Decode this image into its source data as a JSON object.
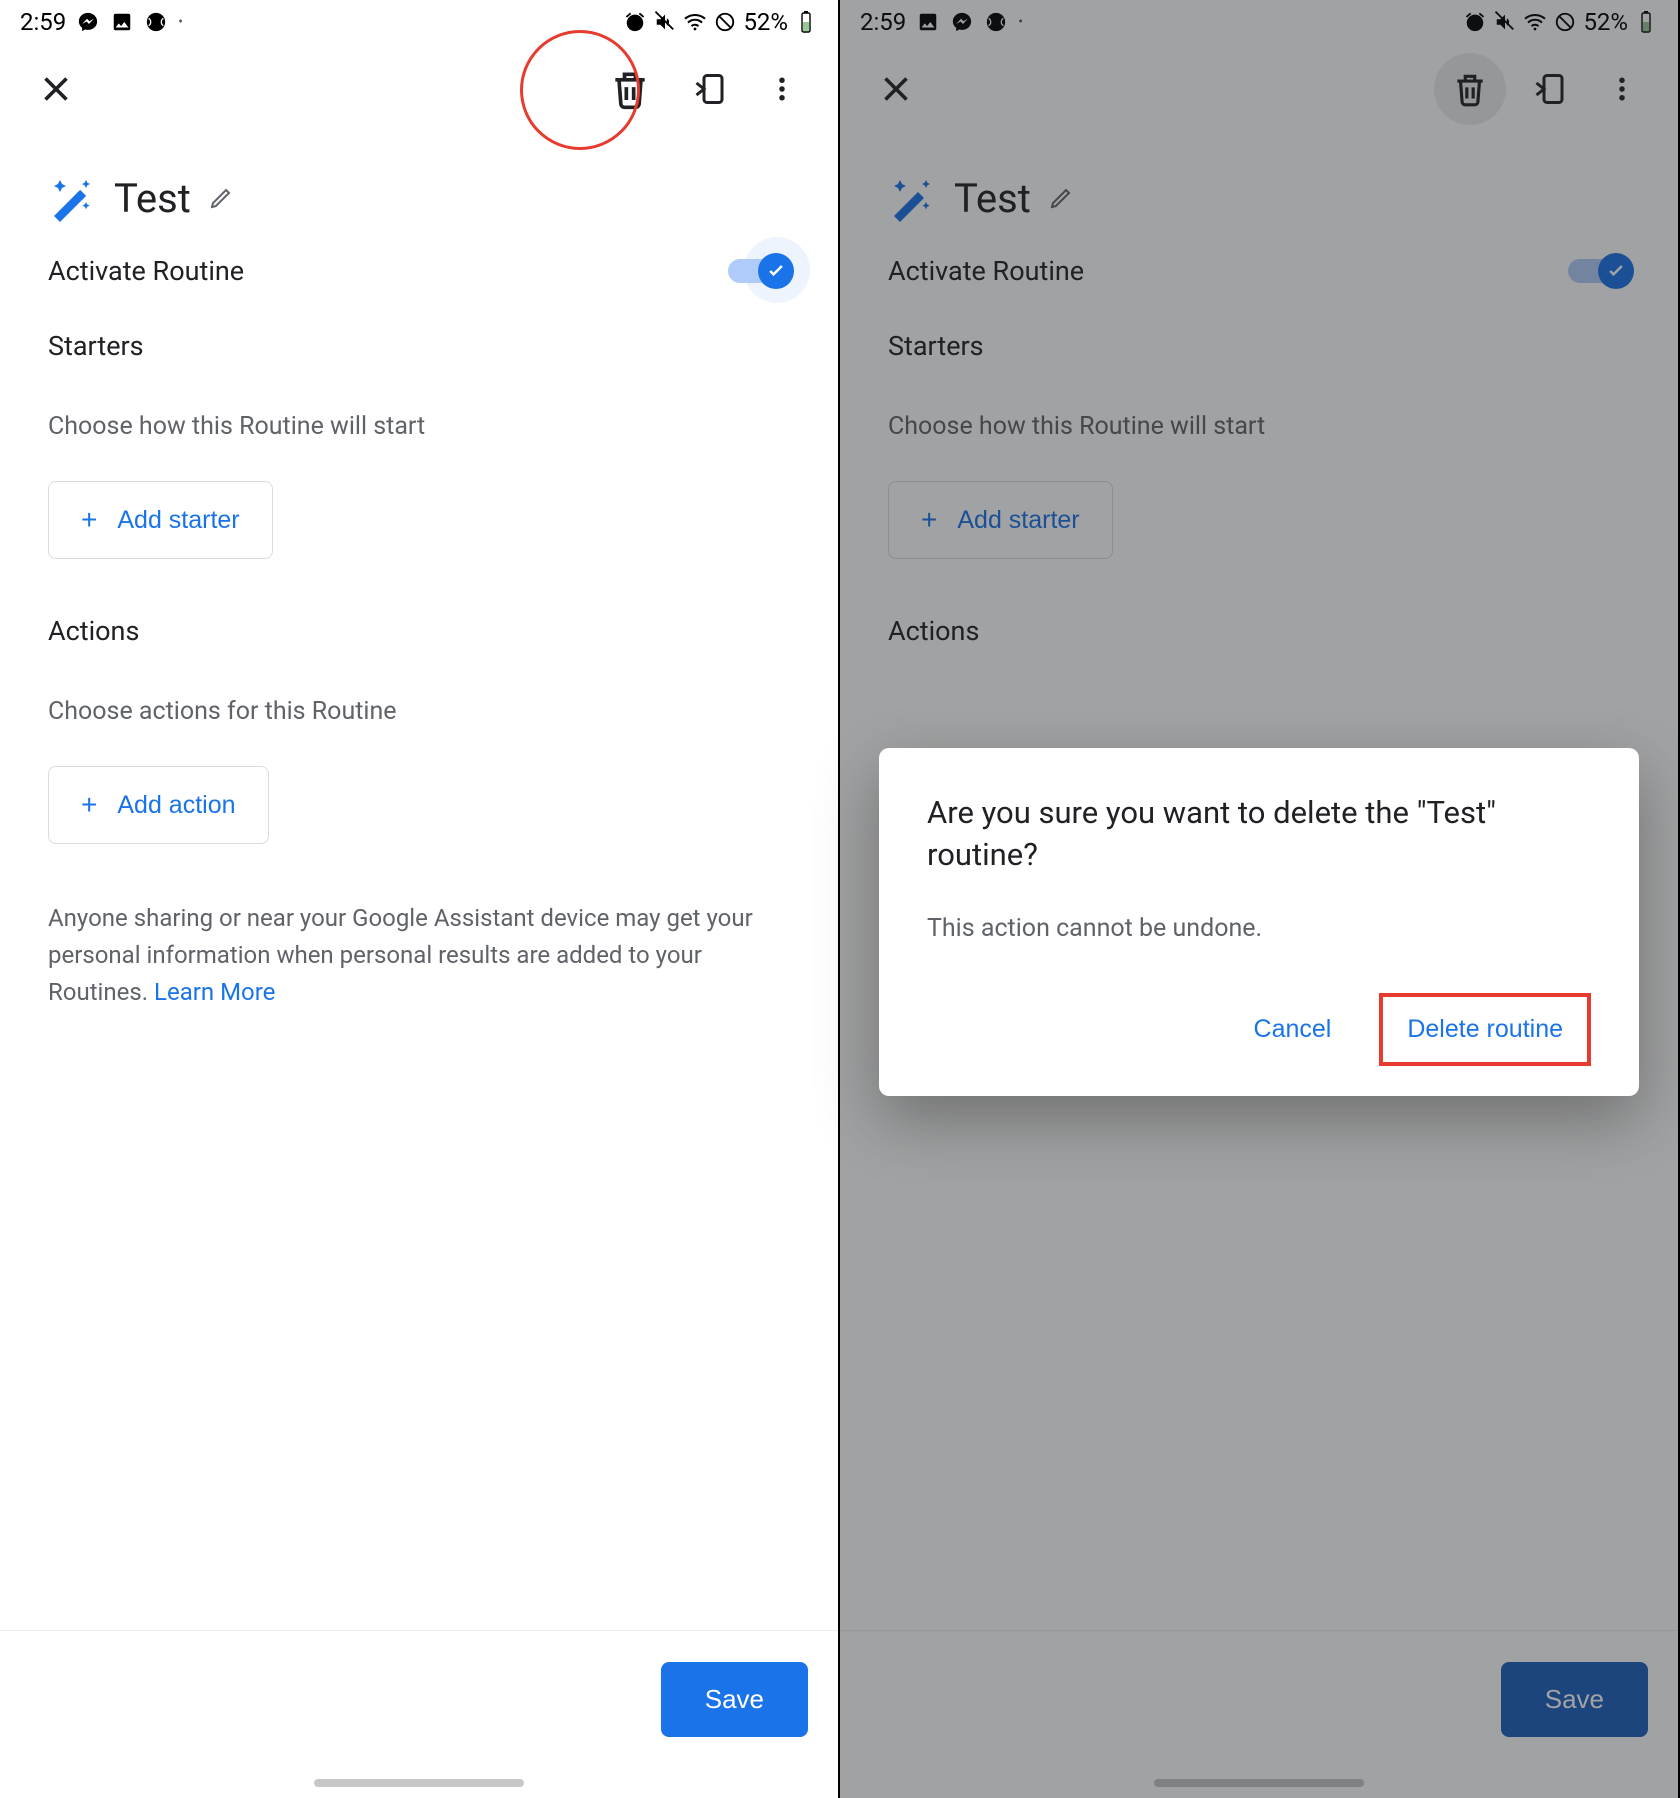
{
  "status": {
    "time": "2:59",
    "battery": "52%"
  },
  "routine": {
    "title": "Test",
    "activate_label": "Activate Routine",
    "starters_heading": "Starters",
    "starters_sub": "Choose how this Routine will start",
    "add_starter_label": "Add starter",
    "actions_heading": "Actions",
    "actions_sub": "Choose actions for this Routine",
    "add_action_label": "Add action",
    "disclaimer": "Anyone sharing or near your Google Assistant device may get your personal information when personal results are added to your Routines. ",
    "learn_more": "Learn More"
  },
  "footer": {
    "save_label": "Save"
  },
  "dialog": {
    "title": "Are you sure you want to delete the \"Test\" routine?",
    "body": "This action cannot be undone.",
    "cancel": "Cancel",
    "confirm": "Delete routine"
  }
}
